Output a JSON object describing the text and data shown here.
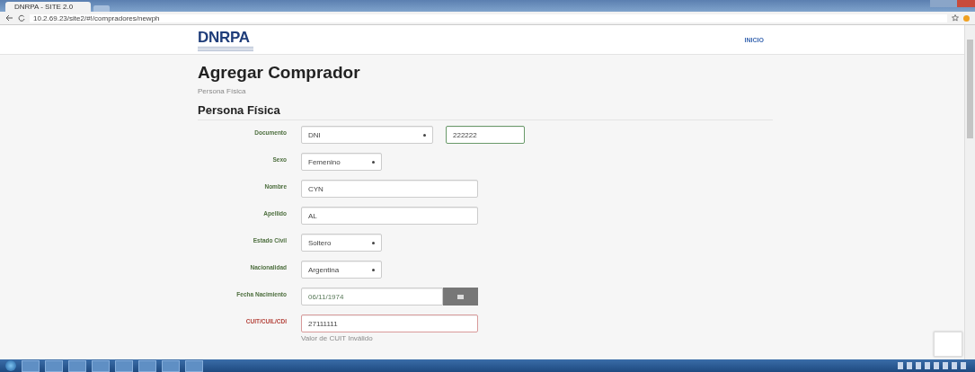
{
  "browser": {
    "tab_title": "DNRPA - SITE 2.0",
    "url": "10.2.69.23/site2/#!/compradores/newph"
  },
  "header": {
    "logo": "DNRPA",
    "nav": [
      {
        "label": "INICIO"
      }
    ]
  },
  "page": {
    "title": "Agregar Comprador",
    "subtitle": "Persona Física",
    "section": "Persona Física"
  },
  "fields": [
    {
      "label": "Documento",
      "invalid": false,
      "controls": [
        {
          "kind": "select",
          "value": "DNI",
          "focused": false
        },
        {
          "kind": "text",
          "value": "222222",
          "focused": true
        }
      ]
    },
    {
      "label": "Sexo",
      "invalid": false,
      "controls": [
        {
          "kind": "select",
          "value": "Femenino",
          "focused": false
        }
      ]
    },
    {
      "label": "Nombre",
      "invalid": false,
      "controls": [
        {
          "kind": "text",
          "value": "CYN",
          "focused": false
        }
      ]
    },
    {
      "label": "Apellido",
      "invalid": false,
      "controls": [
        {
          "kind": "text",
          "value": "AL",
          "focused": false
        }
      ]
    },
    {
      "label": "Estado Civil",
      "invalid": false,
      "controls": [
        {
          "kind": "select",
          "value": "Soltero",
          "focused": false
        }
      ]
    },
    {
      "label": "Nacionalidad",
      "invalid": false,
      "controls": [
        {
          "kind": "select",
          "value": "Argentina",
          "focused": false
        }
      ]
    },
    {
      "label": "Fecha Nacimiento",
      "invalid": false,
      "controls": [
        {
          "kind": "date",
          "value": "06/11/1974",
          "focused": false
        }
      ]
    },
    {
      "label": "CUIT/CUIL/CDI",
      "invalid": true,
      "error": "Valor de CUIT Inválido",
      "controls": [
        {
          "kind": "text",
          "value": "27111111",
          "focused": false
        }
      ]
    }
  ]
}
